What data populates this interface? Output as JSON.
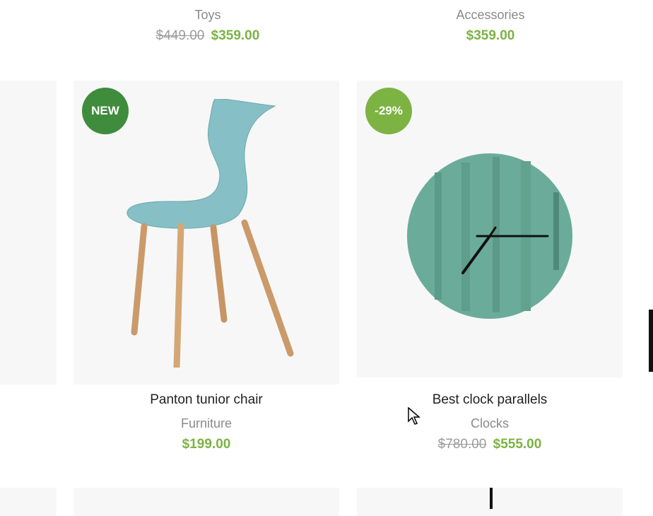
{
  "top_products": [
    {
      "category": "Toys",
      "old_price": "$449.00",
      "price": "$359.00"
    },
    {
      "category": "Accessories",
      "old_price": "",
      "price": "$359.00"
    }
  ],
  "products": [
    {
      "badge": "NEW",
      "badge_color": "#3f8c3c",
      "title": "Panton tunior chair",
      "category": "Furniture",
      "old_price": "",
      "price": "$199.00",
      "image": "chair"
    },
    {
      "badge": "-29%",
      "badge_color": "#7cb342",
      "title": "Best clock parallels",
      "category": "Clocks",
      "old_price": "$780.00",
      "price": "$555.00",
      "image": "clock"
    }
  ],
  "colors": {
    "accent": "#7cb342",
    "badge_new": "#3f8c3c",
    "card_bg": "#f7f7f7"
  }
}
